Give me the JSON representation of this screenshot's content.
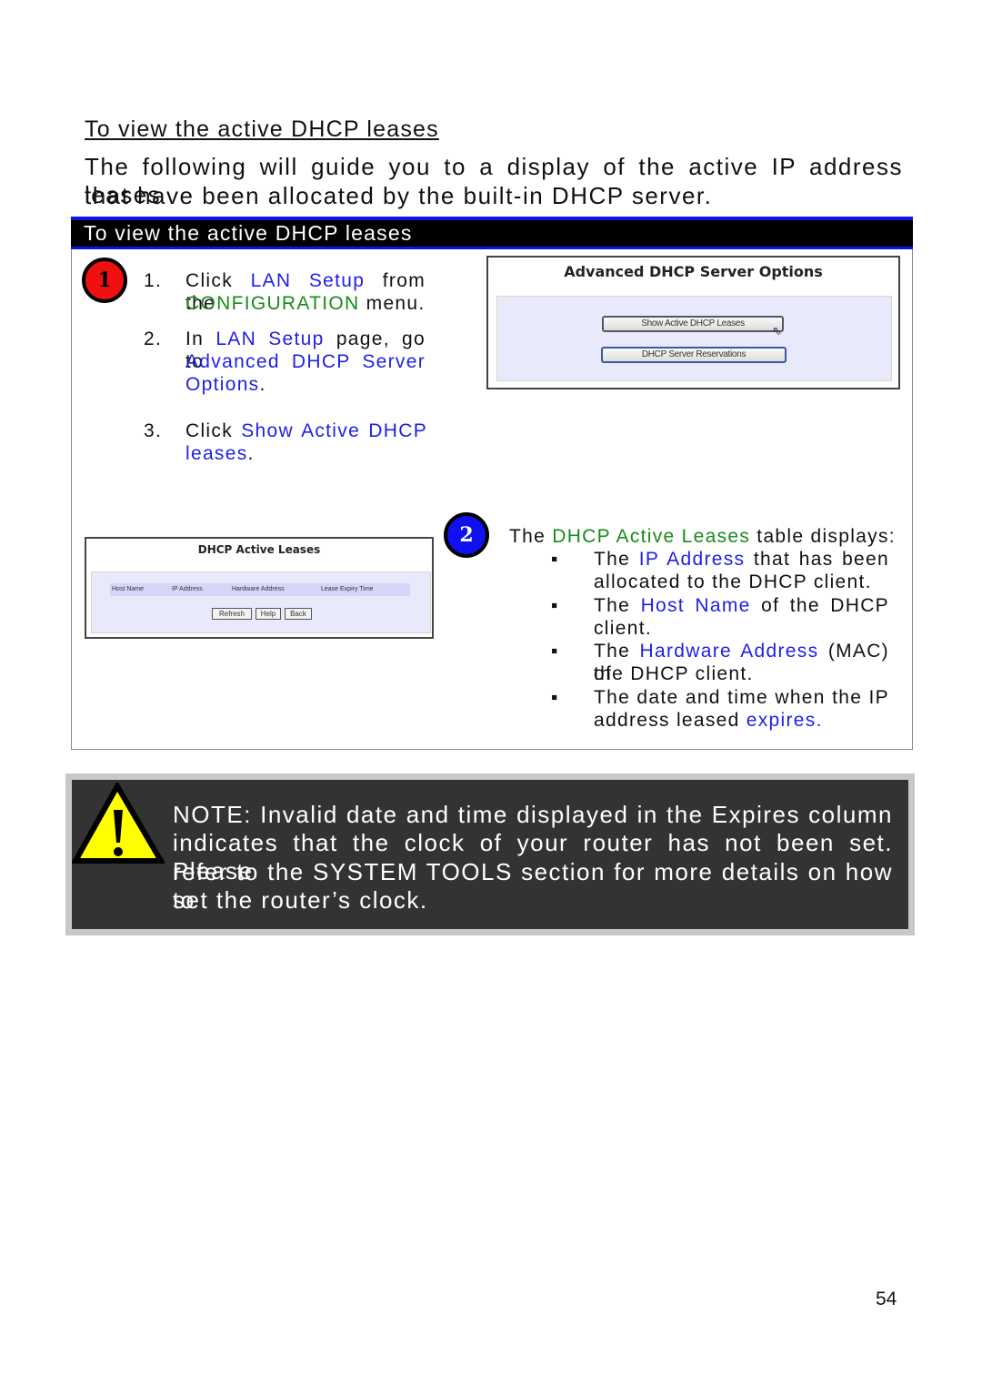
{
  "heading": "To view the active DHCP leases",
  "intro": [
    "The following will guide you to a display of the active IP address leases",
    "that have been allocated by the built-in DHCP server."
  ],
  "box": {
    "title": "To view the active DHCP leases",
    "badge1": "1",
    "badge2": "2",
    "steps": [
      {
        "num": "1.",
        "l1": [
          "Click ",
          "LAN Setup",
          " from the"
        ],
        "l2": [
          "CONFIGURATION",
          " menu."
        ]
      },
      {
        "num": "2.",
        "l1": [
          "In ",
          "LAN Setup",
          " page, go to"
        ],
        "l2": [
          "Advanced DHCP Server"
        ],
        "l3": [
          "Options",
          "."
        ]
      },
      {
        "num": "3.",
        "l1": [
          "Click ",
          "Show Active DHCP"
        ],
        "l2": [
          "leases",
          "."
        ]
      }
    ],
    "adv_screenshot": {
      "title": "Advanced DHCP Server Options",
      "btn1": "Show Active DHCP Leases",
      "btn2": "DHCP Server Reservations"
    },
    "leases_screenshot": {
      "title": "DHCP Active Leases",
      "columns": [
        "Host Name",
        "IP Address",
        "Hardware Address",
        "Lease Expiry Time"
      ],
      "buttons": [
        "Refresh",
        "Help",
        "Back"
      ]
    },
    "table_intro": [
      "The ",
      "DHCP Active Leases",
      " table displays:"
    ],
    "bullets": [
      {
        "l1": [
          "The ",
          "IP Address",
          " that has been"
        ],
        "l2": [
          "allocated to the DHCP client."
        ]
      },
      {
        "l1": [
          "The ",
          "Host Name",
          " of the DHCP"
        ],
        "l2": [
          "client."
        ]
      },
      {
        "l1": [
          "The ",
          "Hardware Address",
          " (MAC) of"
        ],
        "l2": [
          "the DHCP client."
        ]
      },
      {
        "l1": [
          "The date and time when the IP"
        ],
        "l2": [
          "address leased ",
          "expires",
          "."
        ]
      }
    ],
    "bullet_char": "▪"
  },
  "note": {
    "lines": [
      "NOTE:  Invalid date and time displayed in the Expires column",
      "indicates that the clock of your router has not been set. Please",
      "refer to the SYSTEM TOOLS section for more details on how to",
      "set the router’s clock."
    ]
  },
  "page_number": "54",
  "colors": {
    "link_blue": "#1f1fe6",
    "link_green": "#1a8a1a",
    "bar_blue": "#0a14e8",
    "badge1": "#f01010",
    "badge2": "#1010f0",
    "warning_yellow": "#ffff00",
    "note_bg": "#333333"
  }
}
